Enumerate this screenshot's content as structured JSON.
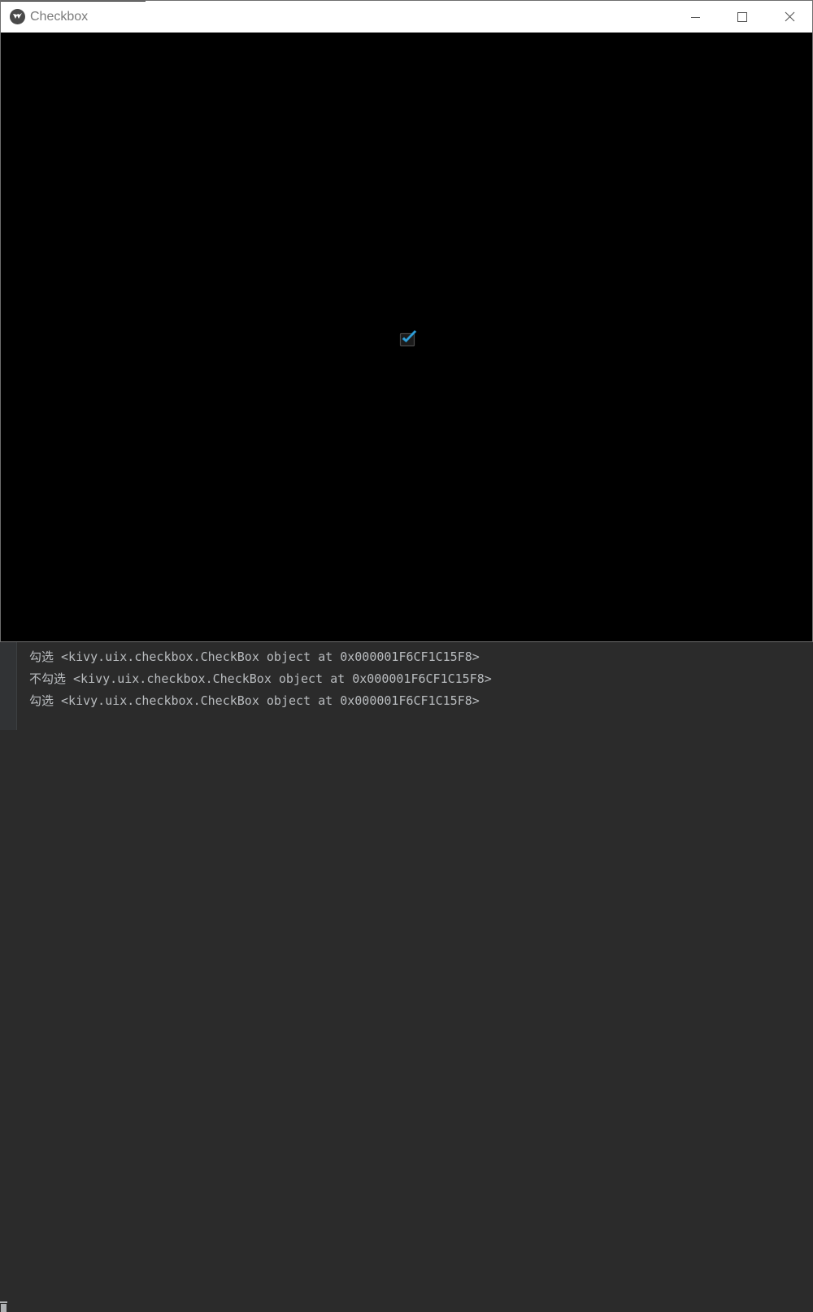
{
  "window": {
    "title": "Checkbox",
    "controls": [
      "minimize",
      "maximize",
      "close"
    ]
  },
  "checkbox": {
    "checked": true,
    "accent_color": "#33a3dc"
  },
  "console": {
    "lines": [
      "勾选 <kivy.uix.checkbox.CheckBox object at 0x000001F6CF1C15F8>",
      "不勾选 <kivy.uix.checkbox.CheckBox object at 0x000001F6CF1C15F8>",
      "勾选 <kivy.uix.checkbox.CheckBox object at 0x000001F6CF1C15F8>"
    ]
  }
}
